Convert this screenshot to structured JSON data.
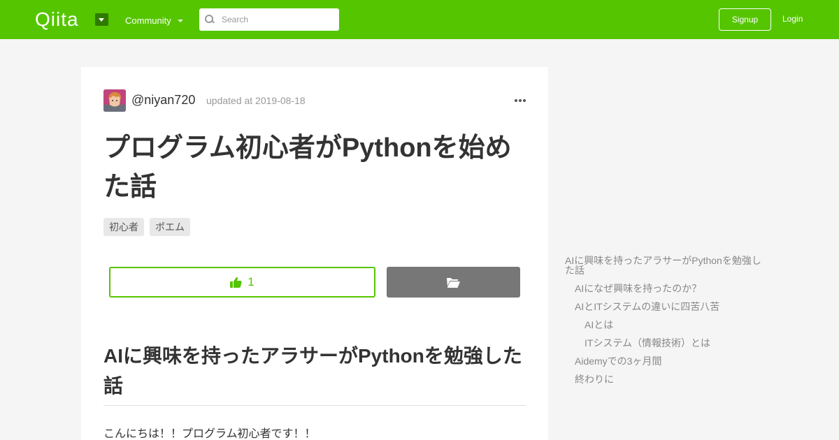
{
  "header": {
    "logo_text": "Qiita",
    "community_label": "Community",
    "search_placeholder": "Search",
    "signup_label": "Signup",
    "login_label": "Login",
    "brand_color": "#55c500"
  },
  "article": {
    "username": "@niyan720",
    "updated": "updated at 2019-08-18",
    "title": "プログラム初心者がPythonを始めた話",
    "tags": [
      "初心者",
      "ポエム"
    ],
    "like_count": "1",
    "heading": "AIに興味を持ったアラサーがPythonを勉強した話",
    "body_first_line": "こんにちは！！プログラム初心者です！！"
  },
  "toc": {
    "items": [
      {
        "label": "AIに興味を持ったアラサーがPythonを勉強した話",
        "level": 1
      },
      {
        "label": "AIになぜ興味を持ったのか？",
        "level": 2
      },
      {
        "label": "AIとITシステムの違いに四苦八苦",
        "level": 2
      },
      {
        "label": "AIとは",
        "level": 3
      },
      {
        "label": "ITシステム（情報技術）とは",
        "level": 3
      },
      {
        "label": "Aidemyでの3ヶ月間",
        "level": 2
      },
      {
        "label": "終わりに",
        "level": 2
      }
    ]
  }
}
